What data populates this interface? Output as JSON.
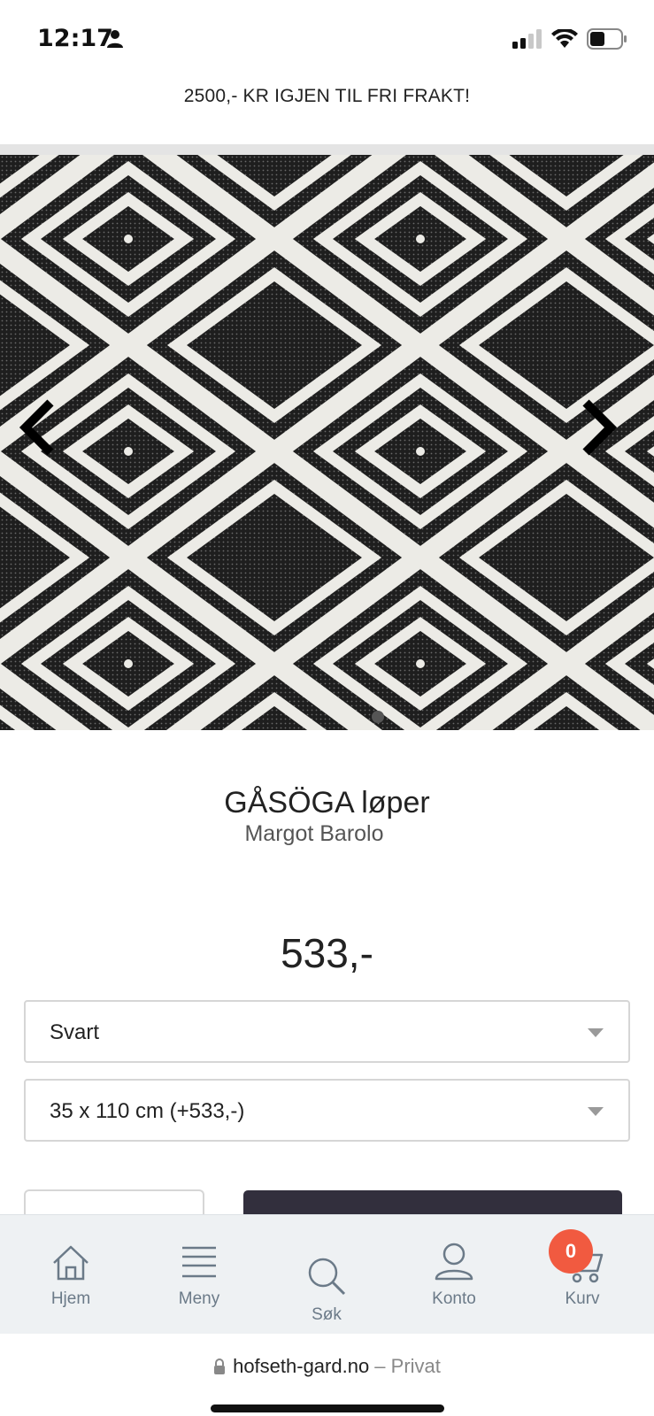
{
  "status_bar": {
    "time": "12:17",
    "icons": [
      "person-icon",
      "cellular-signal-icon",
      "wifi-icon",
      "battery-icon"
    ]
  },
  "promo": {
    "text": "2500,- KR IGJEN TIL FRI FRAKT!"
  },
  "carousel": {
    "image": "black-white-diamond-pattern-rug",
    "prev_icon": "chevron-left-icon",
    "next_icon": "chevron-right-icon"
  },
  "product": {
    "title": "GÅSÖGA løper",
    "brand": "Margot Barolo",
    "price": "533,-"
  },
  "options": {
    "color": {
      "selected": "Svart"
    },
    "size": {
      "selected": "35 x 110 cm (+533,-)"
    }
  },
  "bottom_nav": {
    "items": [
      {
        "label": "Hjem",
        "icon": "home-icon"
      },
      {
        "label": "Meny",
        "icon": "menu-icon"
      },
      {
        "label": "Søk",
        "icon": "search-icon"
      },
      {
        "label": "Konto",
        "icon": "account-icon"
      },
      {
        "label": "Kurv",
        "icon": "cart-icon"
      }
    ],
    "cart_count": "0"
  },
  "url_bar": {
    "domain": "hofseth-gard.no",
    "separator": " – ",
    "mode": "Privat"
  },
  "colors": {
    "badge": "#f15a40",
    "buy_button": "#322f3d",
    "nav_bg": "#eef1f3",
    "nav_text": "#6b7a88"
  }
}
